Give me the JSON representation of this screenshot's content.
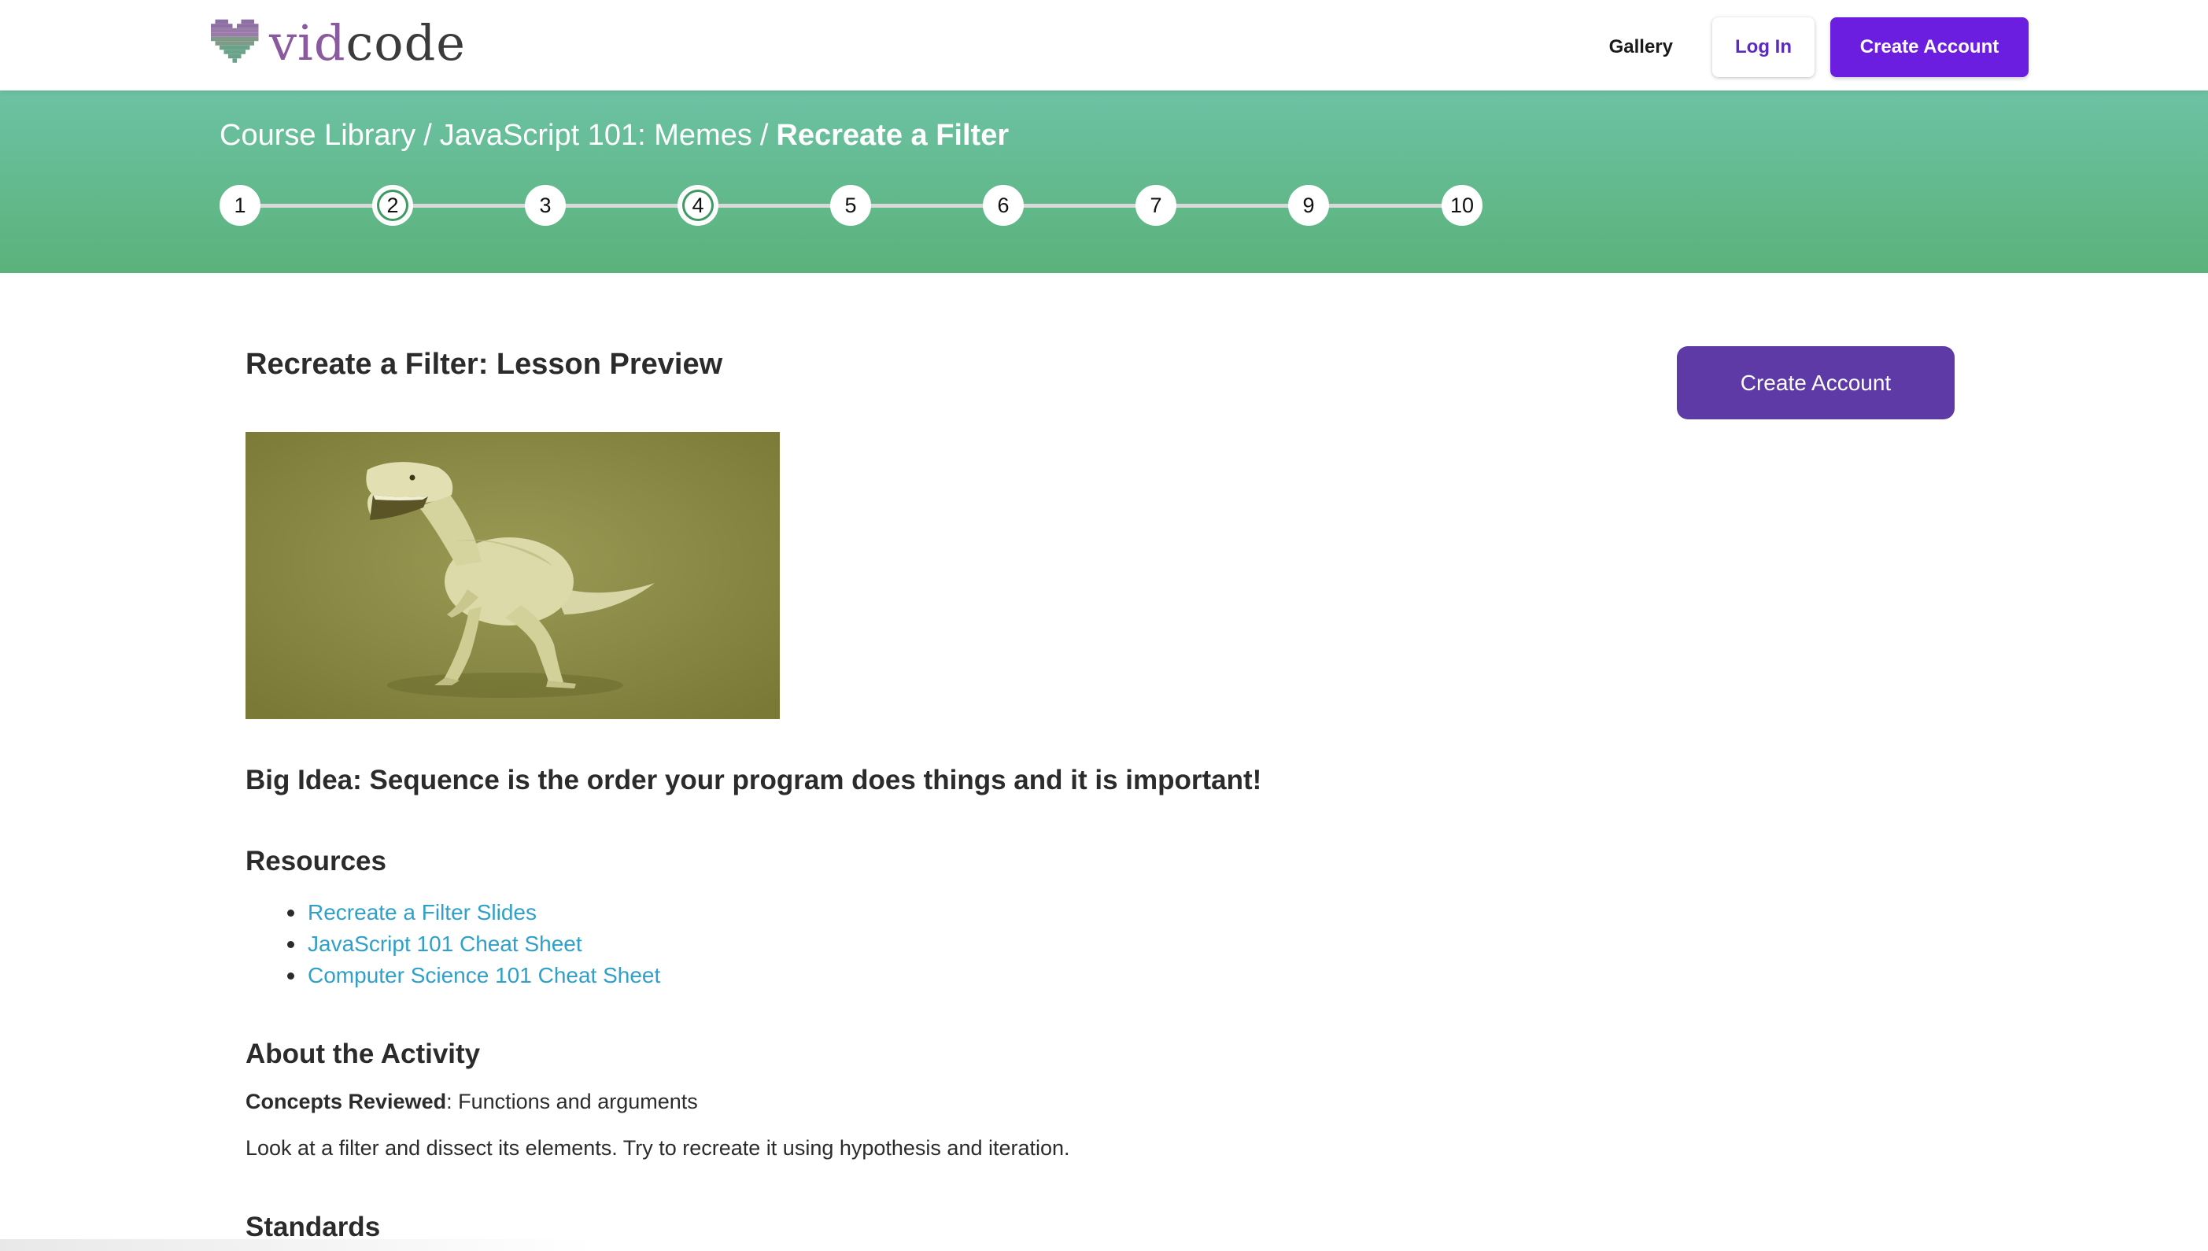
{
  "nav": {
    "logo_part1": "vid",
    "logo_part2": "code",
    "gallery_label": "Gallery",
    "login_label": "Log In",
    "create_account_label": "Create Account"
  },
  "breadcrumb": {
    "items": [
      "Course Library",
      "JavaScript 101: Memes"
    ],
    "current": "Recreate a Filter",
    "separator": "/"
  },
  "steps": [
    {
      "label": "1",
      "done": false
    },
    {
      "label": "2",
      "done": true
    },
    {
      "label": "3",
      "done": false
    },
    {
      "label": "4",
      "done": true
    },
    {
      "label": "5",
      "done": false
    },
    {
      "label": "6",
      "done": false
    },
    {
      "label": "7",
      "done": false
    },
    {
      "label": "9",
      "done": false
    },
    {
      "label": "10",
      "done": false
    }
  ],
  "lesson": {
    "title": "Recreate a Filter: Lesson Preview",
    "create_account_label": "Create Account",
    "preview_image_icon": "dinosaur-video-thumbnail",
    "big_idea": "Big Idea: Sequence is the order your program does things and it is important!"
  },
  "resources": {
    "heading": "Resources",
    "links": [
      "Recreate a Filter Slides",
      "JavaScript 101 Cheat Sheet",
      "Computer Science 101 Cheat Sheet"
    ]
  },
  "activity": {
    "heading": "About the Activity",
    "concepts_label": "Concepts Reviewed",
    "concepts_value": ": Functions and arguments",
    "description": "Look at a filter and dissect its elements. Try to recreate it using hypothesis and iteration."
  },
  "standards": {
    "heading": "Standards"
  },
  "colors": {
    "brand_purple": "#6b1ee0",
    "cta_purple": "#5e3aa6",
    "banner_green": "#5bb27a",
    "link_blue": "#30a0c8"
  }
}
